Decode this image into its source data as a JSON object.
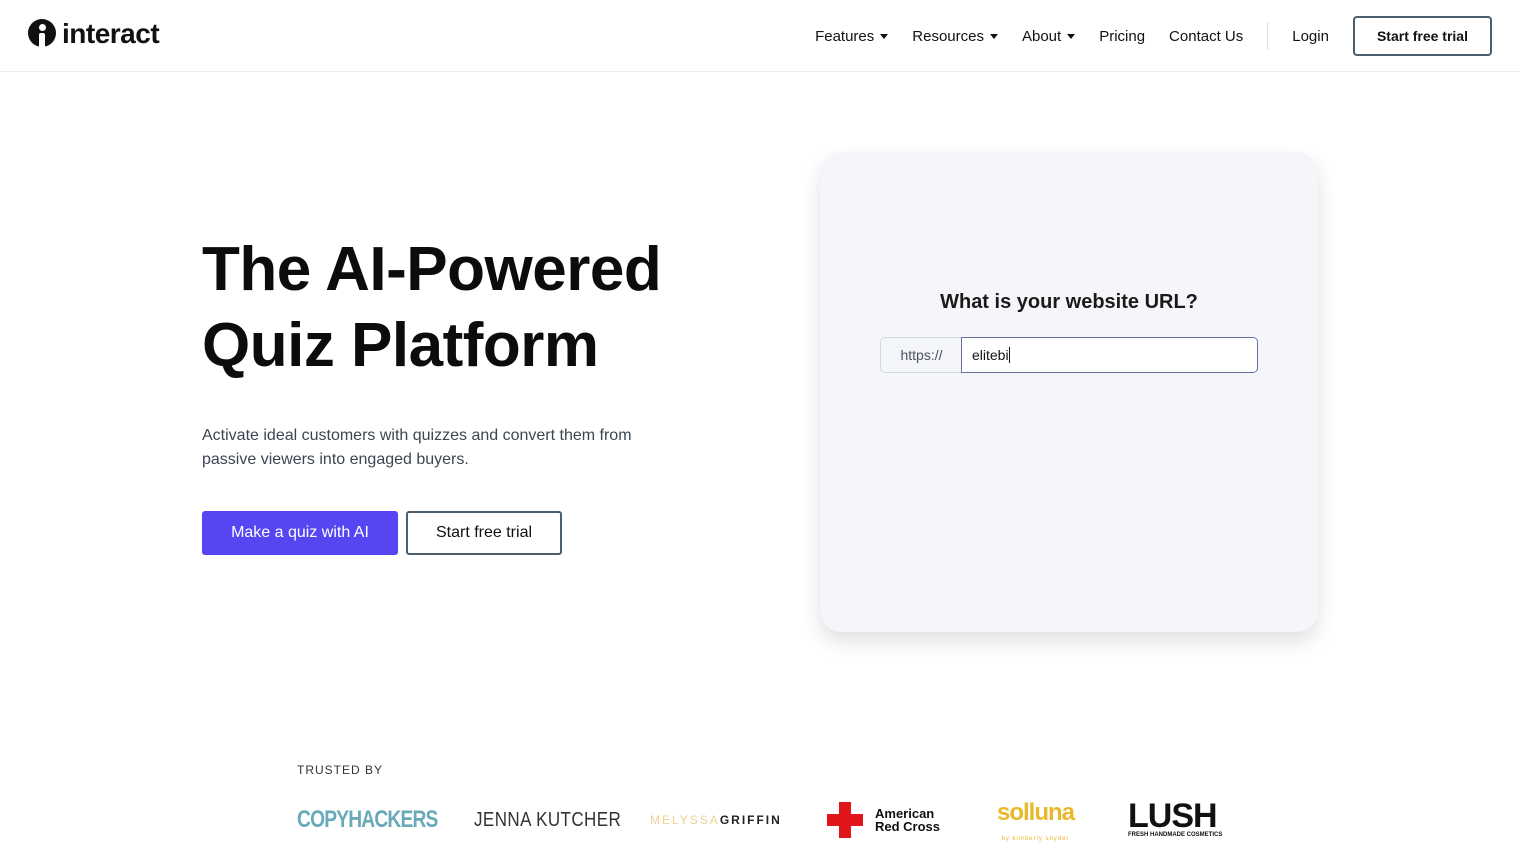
{
  "header": {
    "logo_text": "interact",
    "nav": [
      {
        "label": "Features",
        "dropdown": true
      },
      {
        "label": "Resources",
        "dropdown": true
      },
      {
        "label": "About",
        "dropdown": true
      },
      {
        "label": "Pricing"
      },
      {
        "label": "Contact Us"
      }
    ],
    "login": "Login",
    "cta": "Start free trial"
  },
  "hero": {
    "title_line1": "The AI-Powered",
    "title_line2": "Quiz Platform",
    "subtitle": "Activate ideal customers with quizzes and convert them from passive viewers into engaged buyers.",
    "primary_button": "Make a quiz with AI",
    "secondary_button": "Start free trial"
  },
  "card": {
    "question": "What is your website URL?",
    "prefix": "https://",
    "url_value": "elitebi"
  },
  "trusted": {
    "label": "TRUSTED BY",
    "logos": {
      "copyhackers": "COPYHACKERS",
      "jenna": "JENNA KUTCHER",
      "melyssa_a": "MELYSSA",
      "melyssa_b": "GRIFFIN",
      "redcross_1": "American",
      "redcross_2": "Red Cross",
      "solluna": "solluna",
      "solluna_sub": "by kimberly snyder",
      "lush": "LUSH",
      "lush_sub": "FRESH HANDMADE COSMETICS"
    }
  },
  "colors": {
    "primary": "#5546f2",
    "card_bg": "#f4f6f9",
    "outline": "#4a5e6e"
  }
}
